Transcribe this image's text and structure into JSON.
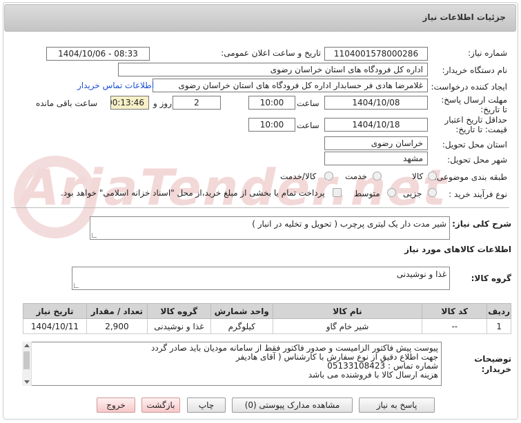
{
  "header": {
    "title": "جزئیات اطلاعات نیاز"
  },
  "fields": {
    "need_number_label": "شماره نیاز:",
    "need_number": "1104001578000286",
    "announce_label": "تاریخ و ساعت اعلان عمومی:",
    "announce_value": "1404/10/06 - 08:33",
    "buyer_label": "نام دستگاه خریدار:",
    "buyer": "اداره کل فرودگاه های استان خراسان رضوی",
    "creator_label": "ایجاد کننده درخواست:",
    "creator": "غلامرضا هادی فر حسابدار اداره کل فرودگاه های استان خراسان رضوی",
    "contact_link": "اطلاعات تماس خریدار",
    "deadline_label": "مهلت ارسال پاسخ: تا تاریخ:",
    "deadline_date": "1404/10/08",
    "time_label": "ساعت",
    "deadline_time": "10:00",
    "days": "2",
    "days_label": "روز و",
    "remaining": "00:13:46",
    "remaining_label": "ساعت باقی مانده",
    "validity_label": "حداقل تاریخ اعتبار قیمت: تا تاریخ:",
    "validity_date": "1404/10/18",
    "validity_time": "10:00",
    "province_label": "استان محل تحویل:",
    "province": "خراسان رضوی",
    "city_label": "شهر محل تحویل:",
    "city": "مشهد",
    "category_label": "طبقه بندی موضوعی:",
    "cat_goods": "کالا",
    "cat_service": "خدمت",
    "cat_goods_service": "کالا/خدمت",
    "process_label": "نوع فرآیند خرید :",
    "proc_partial": "جزیی",
    "proc_medium": "متوسط",
    "payment_note": "پرداخت تمام یا بخشی از مبلغ خرید،از محل \"اسناد خزانه اسلامی\" خواهد بود."
  },
  "description": {
    "label": "شرح کلی نیاز:",
    "value": "شیر مدت دار  یک لیتری پرچرب ( تحویل و تخلیه در انبار )"
  },
  "goods_info_title": "اطلاعات کالاهای مورد نیاز",
  "goods_group": {
    "label": "گروه کالا:",
    "value": "غذا و نوشیدنی"
  },
  "table": {
    "headers": [
      "ردیف",
      "کد کالا",
      "نام کالا",
      "واحد شمارش",
      "گروه کالا",
      "تعداد / مقدار",
      "تاریخ نیاز"
    ],
    "rows": [
      [
        "1",
        "--",
        "شیر خام گاو",
        "کیلوگرم",
        "غذا و نوشیدنی",
        "2,900",
        "1404/10/11"
      ]
    ]
  },
  "buyer_notes": {
    "label": "توضیحات خریدار:",
    "lines": [
      "پیوست پیش فاکتور الزامیست و صدور فاکتور فقط از سامانه مودیان باید صادر گردد",
      "جهت اطلاع دقیق از نوع سفارش با کارشناس  ( آقای هادیفر",
      "شماره تماس :  05133108423",
      "هزینه ارسال کالا با فروشنده می باشد"
    ]
  },
  "buttons": {
    "reply": "پاسخ به نیاز",
    "view_docs": "مشاهده مدارک پیوستی (0)",
    "print": "چاپ",
    "back": "بازگشت",
    "exit": "خروج"
  },
  "watermark": "AriaTender.net",
  "colors": {
    "link": "#1a4fd6",
    "remaining_bg": "#f7f0c8",
    "exit_btn": "#f6c8c8"
  }
}
